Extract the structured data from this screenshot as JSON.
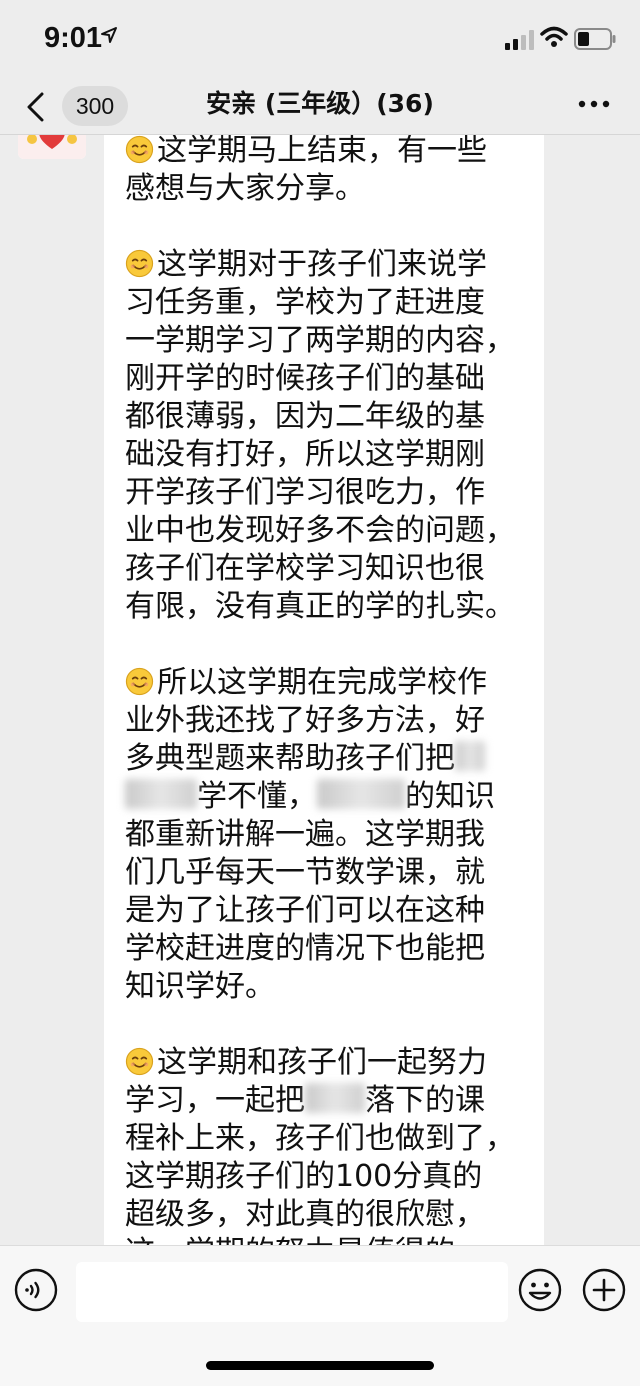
{
  "status_bar": {
    "time": "9:01",
    "icons": [
      "location-arrow-icon",
      "cellular-signal-icon",
      "wifi-icon",
      "battery-icon"
    ]
  },
  "nav": {
    "back_icon": "chevron-left-icon",
    "unread_count": "300",
    "title": "安亲 (三年级）(36)",
    "more_icon": "more-dots-icon"
  },
  "message": {
    "emoji": "smiling-face-icon",
    "paragraphs": [
      {
        "lines": [
          "这学期马上结束，有一些",
          "感想与大家分享。"
        ]
      },
      {
        "lines": [
          "这学期对于孩子们来说学",
          "习任务重，学校为了赶进度",
          "一学期学习了两学期的内容，",
          "刚开学的时候孩子们的基础",
          "都很薄弱，因为二年级的基",
          "础没有打好，所以这学期刚",
          "开学孩子们学习很吃力，作",
          "业中也发现好多不会的问题，",
          "孩子们在学校学习知识也很",
          "有限，没有真正的学的扎实。"
        ]
      },
      {
        "lines": [
          "所以这学期在完成学校作",
          "业外我还找了好多方法，好",
          "多典型题来帮助孩子们把",
          "学不懂，",
          "都重新讲解一遍。这学期我",
          "们几乎每天一节数学课，就",
          "是为了让孩子们可以在这种",
          "学校赶进度的情况下也能把",
          "知识学好。"
        ],
        "line4_suffix": "的知识"
      },
      {
        "lines": [
          "这学期和孩子们一起努力",
          "学习，一起把",
          "落下的课",
          "程补上来，孩子们也做到了，",
          "这学期孩子们的100分真的",
          "超级多，对此真的很欣慰，",
          "这一学期的努力是值得的。"
        ]
      }
    ]
  },
  "input_bar": {
    "voice_icon": "voice-icon",
    "emoji_icon": "emoji-icon",
    "plus_icon": "plus-icon",
    "input_value": ""
  },
  "colors": {
    "background": "#ededed",
    "bubble": "#ffffff",
    "text": "#111111"
  }
}
